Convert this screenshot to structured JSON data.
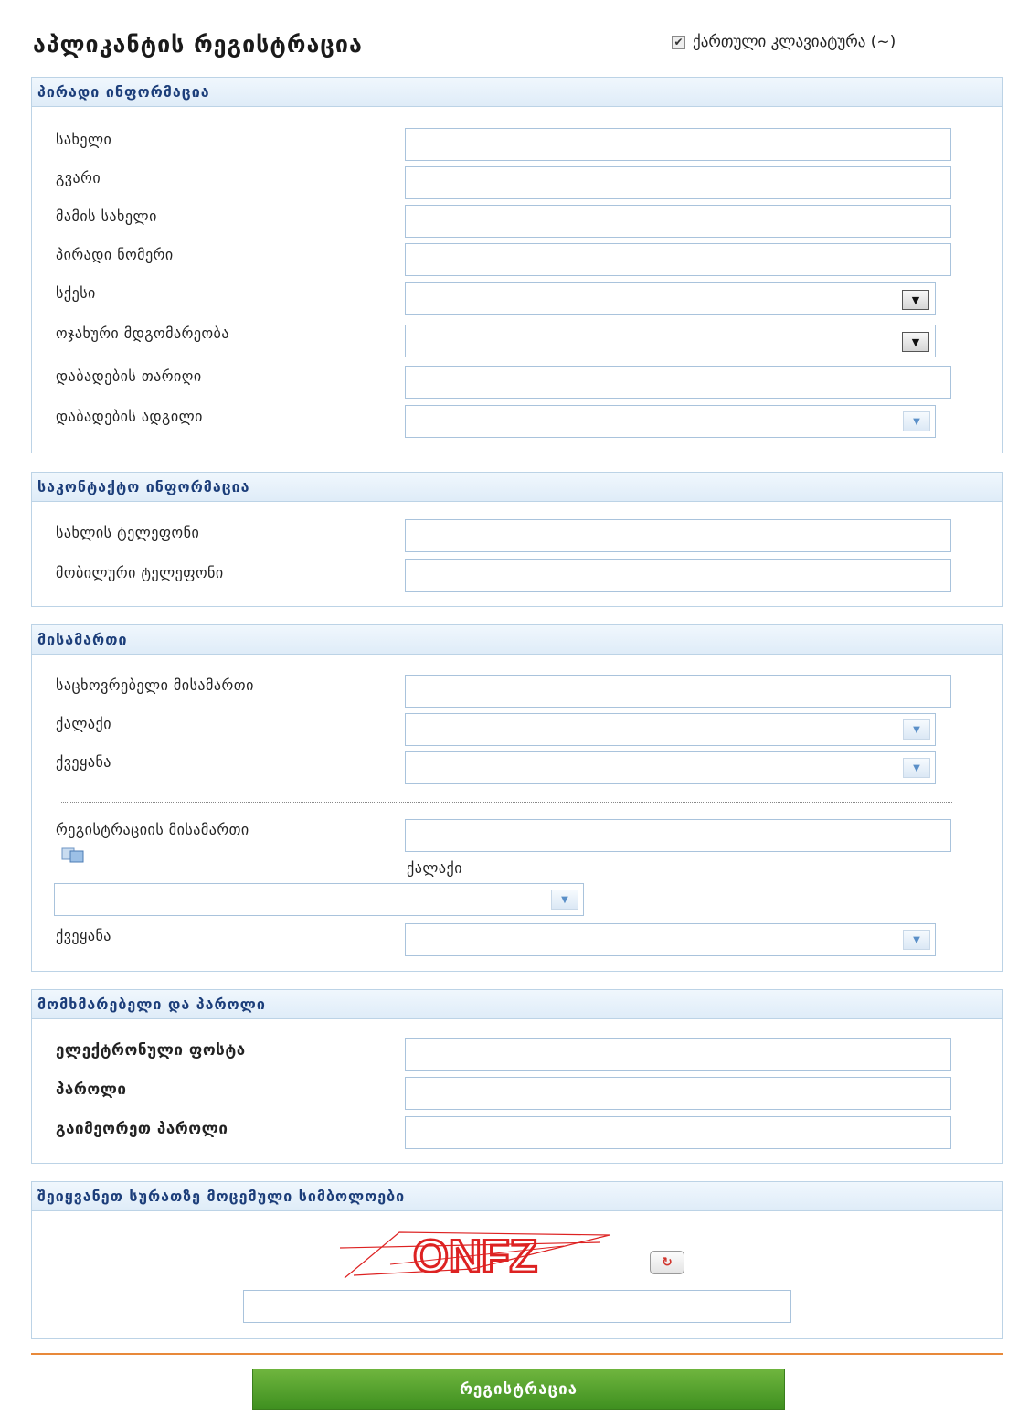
{
  "page": {
    "title": "აპლიკანტის რეგისტრაცია",
    "keyboard_toggle": {
      "checked": true,
      "label": "ქართული კლავიატურა (~)"
    }
  },
  "personal": {
    "header": "პირადი ინფორმაცია",
    "first_name": "სახელი",
    "last_name": "გვარი",
    "father_name": "მამის სახელი",
    "personal_number": "პირადი ნომერი",
    "gender": "სქესი",
    "marital_status": "ოჯახური მდგომარეობა",
    "birth_date": "დაბადების თარიღი",
    "birth_place": "დაბადების ადგილი"
  },
  "contact": {
    "header": "საკონტაქტო ინფორმაცია",
    "home_phone": "სახლის ტელეფონი",
    "mobile_phone": "მობილური ტელეფონი"
  },
  "address": {
    "header": "მისამართი",
    "residential": "საცხოვრებელი მისამართი",
    "city": "ქალაქი",
    "country": "ქვეყანა",
    "registration": "რეგისტრაციის მისამართი",
    "reg_city": "ქალაქი",
    "reg_country": "ქვეყანა"
  },
  "account": {
    "header": "მომხმარებელი და პაროლი",
    "email": "ელექტრონული ფოსტა",
    "password": "პაროლი",
    "password_repeat": "გაიმეორეთ პაროლი"
  },
  "captcha": {
    "header": "შეიყვანეთ სურათზე მოცემული სიმბოლოები",
    "text": "ONFZ"
  },
  "submit_label": "რეგისტრაცია",
  "colors": {
    "accent": "#1c3e7a",
    "button": "#4f9e2c",
    "separator": "#e8893a"
  }
}
